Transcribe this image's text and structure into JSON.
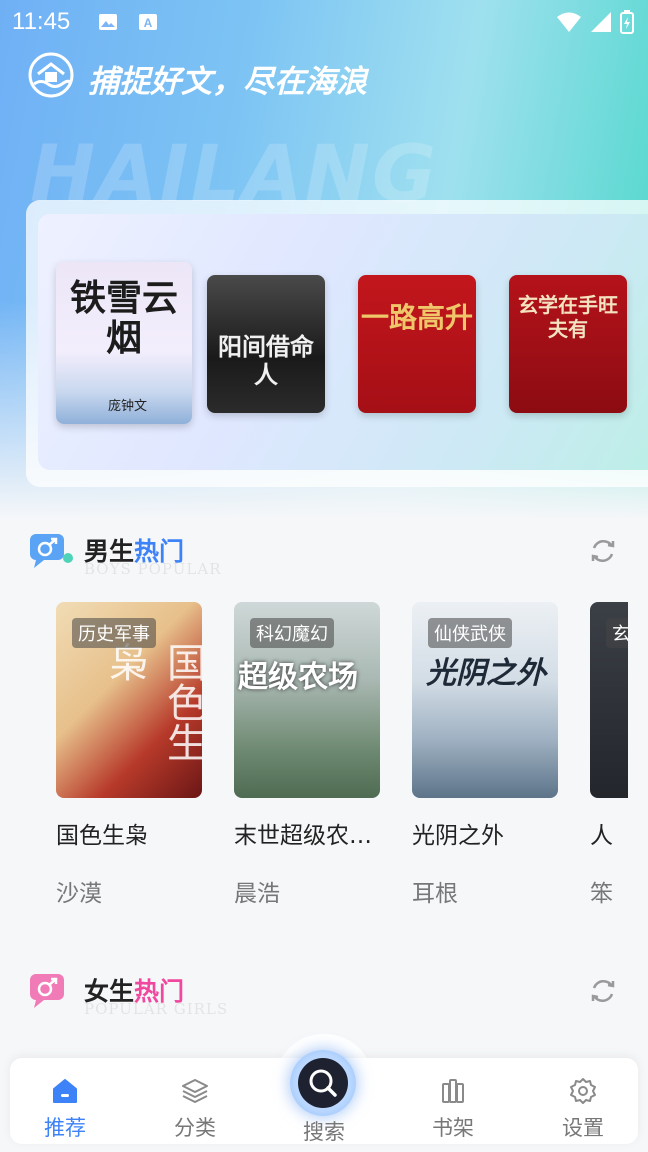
{
  "status_bar": {
    "time": "11:45"
  },
  "header": {
    "slogan": "捕捉好文，尽在海浪",
    "watermark": "HAILANG"
  },
  "featured": [
    {
      "title": "铁雪云烟",
      "author": "庞钟文"
    },
    {
      "title": "阳间借命人",
      "author": ""
    },
    {
      "title": "一路高升",
      "author": ""
    },
    {
      "title": "玄学在手旺夫有",
      "author": ""
    }
  ],
  "male_section": {
    "title_prefix": "男生",
    "title_hot": "热门",
    "subtitle": "BOYS POPULAR",
    "books": [
      {
        "tag": "历史军事",
        "name": "国色生枭",
        "author": "沙漠",
        "cover_title": "国色生枭"
      },
      {
        "tag": "科幻魔幻",
        "name": "末世超级农…",
        "author": "晨浩",
        "cover_title": "超级农场"
      },
      {
        "tag": "仙侠武侠",
        "name": "光阴之外",
        "author": "耳根",
        "cover_title": "光阴之外"
      },
      {
        "tag": "玄",
        "name": "人being",
        "author": "笨"
      }
    ]
  },
  "female_section": {
    "title_prefix": "女生",
    "title_hot": "热门",
    "subtitle": "POPULAR GIRLS"
  },
  "nav": {
    "items": [
      {
        "label": "推荐",
        "icon": "home-icon"
      },
      {
        "label": "分类",
        "icon": "layers-icon"
      },
      {
        "label": "搜索",
        "icon": "search-icon"
      },
      {
        "label": "书架",
        "icon": "bookshelf-icon"
      },
      {
        "label": "设置",
        "icon": "gear-icon"
      }
    ]
  },
  "colors": {
    "accent": "#3e82f7",
    "hero_start": "#6fb0f5",
    "hero_end": "#4ad7c9"
  }
}
